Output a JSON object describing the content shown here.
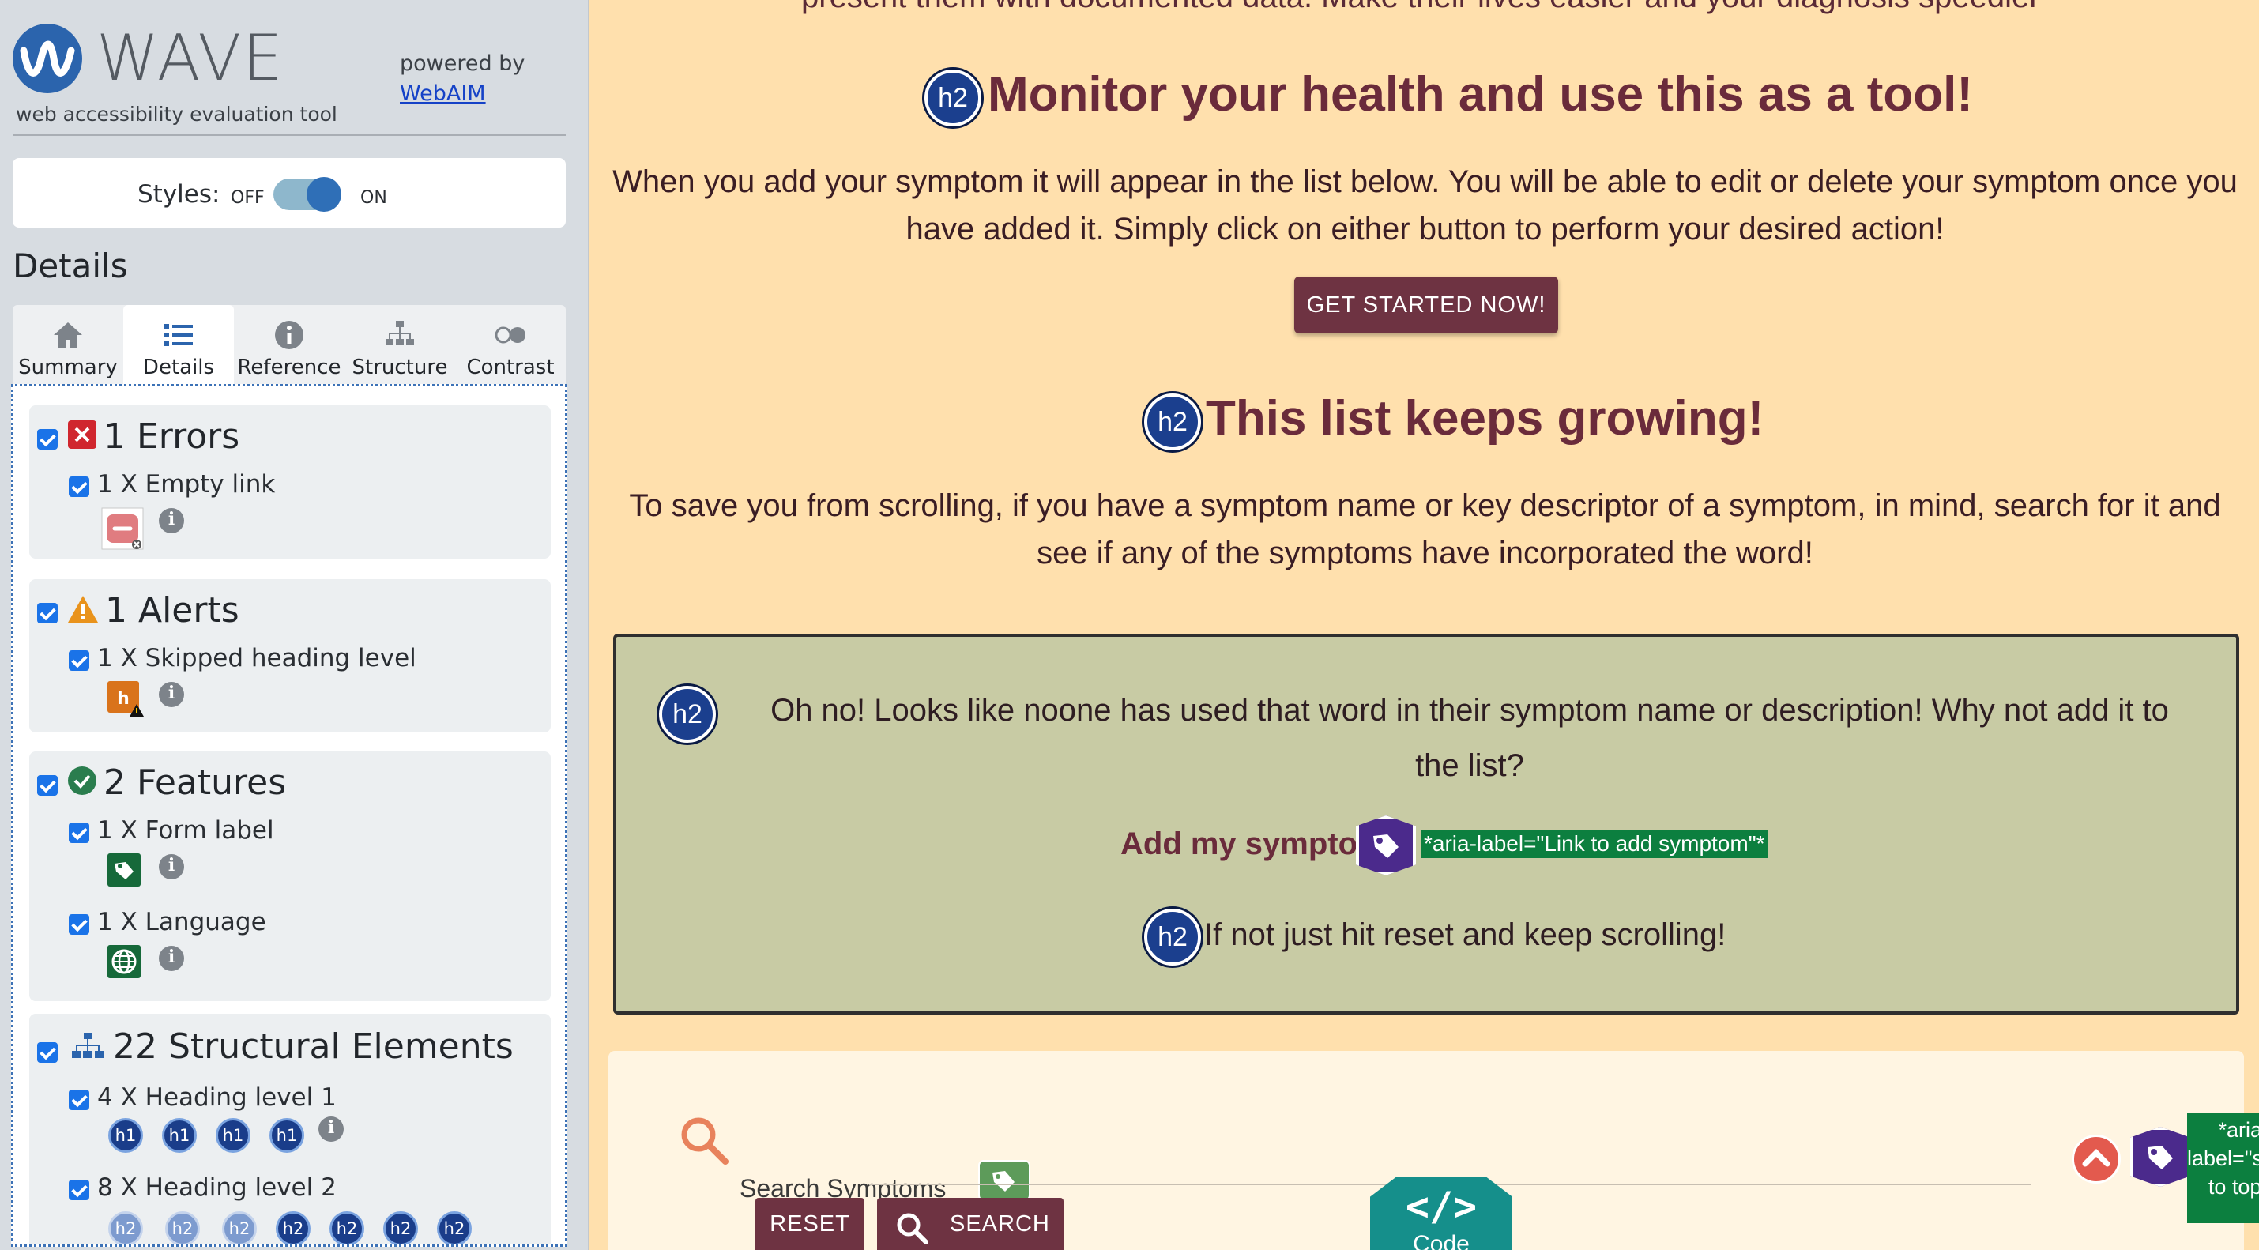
{
  "wave": {
    "brand": "WAVE",
    "tagline": "web accessibility evaluation tool",
    "powered_by": "powered by",
    "webaim_link": "WebAIM",
    "styles_label": "Styles:",
    "styles_off": "OFF",
    "styles_on": "ON",
    "details_heading": "Details",
    "tabs": [
      {
        "label": "Summary",
        "icon": "home-icon"
      },
      {
        "label": "Details",
        "icon": "list-icon"
      },
      {
        "label": "Reference",
        "icon": "info-icon"
      },
      {
        "label": "Structure",
        "icon": "sitemap-icon"
      },
      {
        "label": "Contrast",
        "icon": "contrast-icon"
      }
    ],
    "active_tab": "Details",
    "categories": {
      "errors": {
        "title": "1 Errors",
        "items": [
          "1 X Empty link"
        ]
      },
      "alerts": {
        "title": "1 Alerts",
        "items": [
          "1 X Skipped heading level"
        ]
      },
      "features": {
        "title": "2 Features",
        "items": [
          "1 X Form label",
          "1 X Language"
        ]
      },
      "structure": {
        "title": "22 Structural Elements",
        "items": [
          "4 X Heading level 1",
          "8 X Heading level 2"
        ]
      }
    },
    "badge_h1": "h1",
    "badge_h2": "h2"
  },
  "page": {
    "top_cut_text": "present them with documented data. Make their lives easier and your diagnosis speedier",
    "section1_title": "Monitor your health and use this as a tool!",
    "section1_line1": "When you add your symptom it will appear in the list below. You will be able to edit or delete your symptom once you",
    "section1_line2": "have added it. Simply click on either button to perform your desired action!",
    "get_started": "GET STARTED NOW!",
    "section2_title": "This list keeps growing!",
    "section2_line1": "To save you from scrolling, if you have a symptom name or key descriptor of a symptom, in mind, search for it and",
    "section2_line2": "see if any of the symptoms have incorporated the word!",
    "callout_line1": "Oh no! Looks like noone has used that word in their symptom name or description! Why not add it to",
    "callout_line2": "the list?",
    "add_symptom": "Add my symptom",
    "aria_add": "*aria-label=\"Link to add symptom\"*",
    "callout_reset": "If not just hit reset and keep scrolling!",
    "search_label": "Search Symptoms",
    "reset": "RESET",
    "search": "SEARCH",
    "code_symbol": "</>",
    "code_label": "Code",
    "aria_side_1": "*aria-",
    "aria_side_2": "label=\"sc",
    "aria_side_3": "to top\""
  },
  "colors": {
    "page_bg": "#ffe0ad",
    "heading": "#6a2b3b",
    "button": "#6e3342",
    "callout_bg": "#c8cba4",
    "wave_blue": "#2b64ad"
  }
}
